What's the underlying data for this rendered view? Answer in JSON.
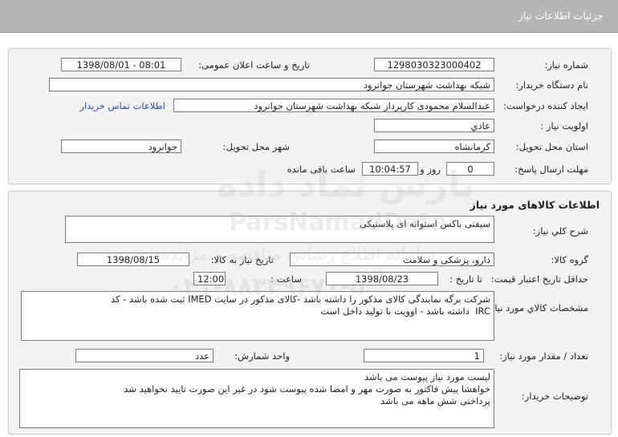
{
  "header": {
    "title": "جزئیات اطلاعات نیاز"
  },
  "need_info": {
    "need_number_label": "شماره نیاز:",
    "need_number": "1298030323000402",
    "announce_datetime_label": "تاریخ و ساعت اعلان عمومی:",
    "announce_datetime": "1398/08/01 - 08:01",
    "buyer_org_label": "نام دستگاه خریدار:",
    "buyer_org": "شبکه بهداشت شهرستان جوانرود",
    "requester_label": "ایجاد کننده درخواست:",
    "requester": "عبدالسلام محمودی کارپرداز شبکه بهداشت شهرستان جوانرود",
    "contact_link": "اطلاعات تماس خریدار",
    "priority_label": "اولویت نیاز :",
    "priority": "عادي",
    "province_label": "استان محل تحویل:",
    "province": "کرمانشاه",
    "city_label": "شهر محل تحویل:",
    "city": "جوانرود",
    "deadline_label": "مهلت ارسال پاسخ:",
    "deadline_days": "0",
    "days_and_label": "روز و",
    "deadline_time": "10:04:57",
    "remaining_label": "ساعت باقی مانده"
  },
  "goods": {
    "section_title": "اطلاعات کالاهای مورد نیاز",
    "description_label": "شرح کلي نياز:",
    "description": "سیفتی باکس استوانه ای پلاستیکی",
    "group_label": "گروه کالا:",
    "group": "دارو، پزشکی و سلامت",
    "need_date_label": "تاریخ نیاز به کالا:",
    "need_date": "1398/08/15",
    "validity_label": "حداقل تاریخ اعتبار قیمت:",
    "until_date_label": "تا تاریخ :",
    "validity_date": "1398/08/23",
    "hour_label": "ساعت :",
    "validity_time": "12:00",
    "specs_label": "مشخصات کالاي مورد نياز:",
    "specs_lines": [
      "شرکت برگه نمایندگی کالای مذکور را داشته باشد -کالای مذکور در سایت IMED ثبت شده باشد - کد",
      "IRC  داشته باشد - اوویت با تولید داخل است"
    ],
    "quantity_label": "تعداد / مقدار مورد نیاز:",
    "quantity": "1",
    "unit_label": "واحد شمارش:",
    "unit": "عدد",
    "notes_label": "توضیحات خریدار:",
    "notes_lines": [
      "لیست مورد نیاز پیوست می باشد",
      "خواهشا پیش فاکتور به صورت مهر و امضا شده پیوست شود در غیر این صورت تایید نخواهید شد",
      "پرداختی شش ماهه می باشد"
    ]
  },
  "watermark": {
    "brand": "ParsNamadData",
    "brand_fa": "پارس نماد داده",
    "subtitle": "سامانه اطلاع رسانی مناقصه و مزایده",
    "phone": "۰۲۱-۸۸۳۴۹۶۷۰-۵"
  }
}
